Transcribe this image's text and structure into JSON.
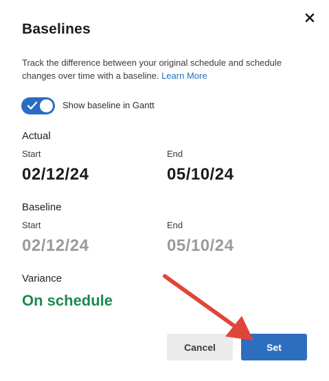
{
  "dialog": {
    "title": "Baselines",
    "close_icon": "close-icon",
    "description": "Track the difference between your original schedule and schedule changes over time with a baseline.",
    "learn_more_label": "Learn More"
  },
  "toggle": {
    "label": "Show baseline in Gantt",
    "checked": true,
    "color": "#2a6cc4"
  },
  "actual": {
    "heading": "Actual",
    "start_label": "Start",
    "start_value": "02/12/24",
    "end_label": "End",
    "end_value": "05/10/24"
  },
  "baseline": {
    "heading": "Baseline",
    "start_label": "Start",
    "start_value": "02/12/24",
    "end_label": "End",
    "end_value": "05/10/24"
  },
  "variance": {
    "heading": "Variance",
    "value": "On schedule",
    "color": "#1a8a4e"
  },
  "footer": {
    "cancel_label": "Cancel",
    "set_label": "Set",
    "set_color": "#2e6ebe"
  },
  "annotation": {
    "arrow_color": "#e0453a",
    "arrow_target": "set-button"
  }
}
